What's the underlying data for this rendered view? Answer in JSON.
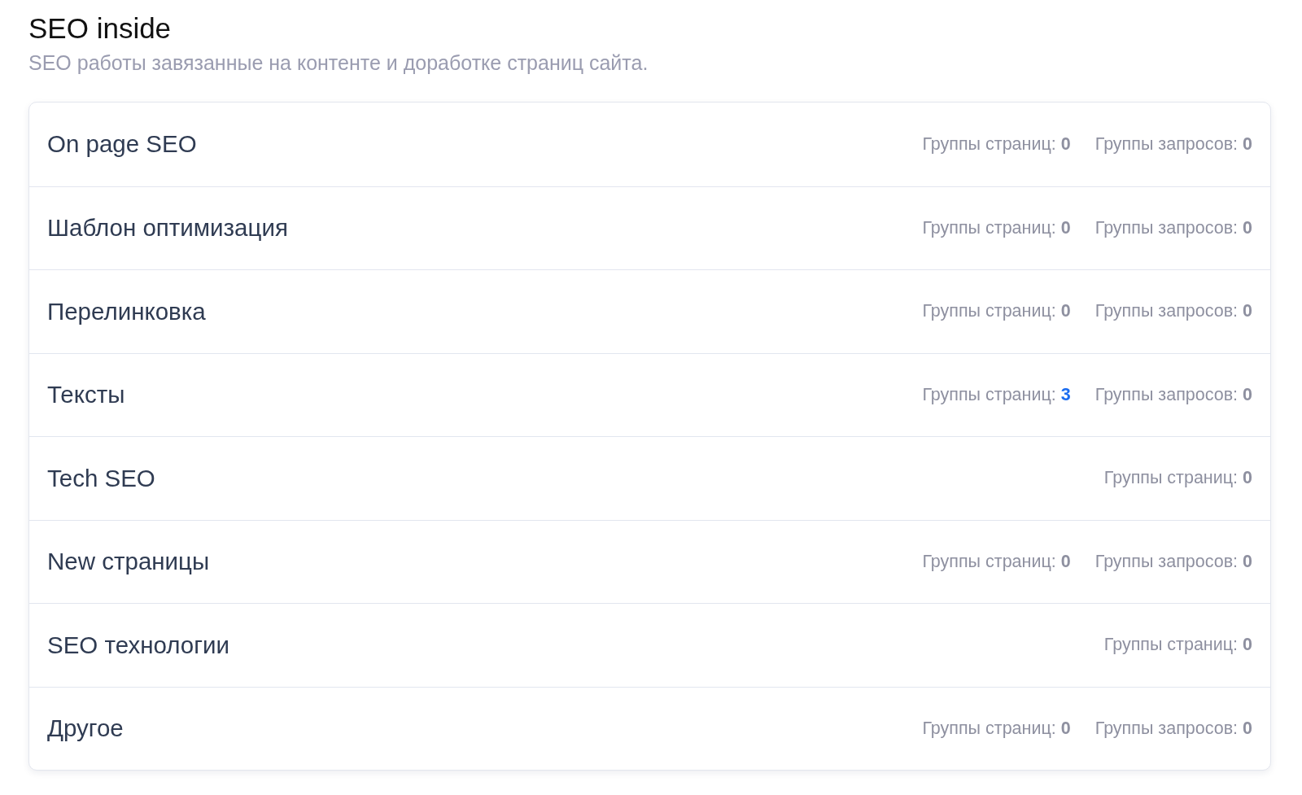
{
  "header": {
    "title": "SEO inside",
    "subtitle": "SEO работы завязанные на контенте и доработке страниц сайта."
  },
  "categories": [
    {
      "name": "On page SEO",
      "stats": [
        {
          "label": "Группы страниц:",
          "value": "0",
          "highlighted": false
        },
        {
          "label": "Группы запросов:",
          "value": "0",
          "highlighted": false
        }
      ]
    },
    {
      "name": "Шаблон оптимизация",
      "stats": [
        {
          "label": "Группы страниц:",
          "value": "0",
          "highlighted": false
        },
        {
          "label": "Группы запросов:",
          "value": "0",
          "highlighted": false
        }
      ]
    },
    {
      "name": "Перелинковка",
      "stats": [
        {
          "label": "Группы страниц:",
          "value": "0",
          "highlighted": false
        },
        {
          "label": "Группы запросов:",
          "value": "0",
          "highlighted": false
        }
      ]
    },
    {
      "name": "Тексты",
      "stats": [
        {
          "label": "Группы страниц:",
          "value": "3",
          "highlighted": true
        },
        {
          "label": "Группы запросов:",
          "value": "0",
          "highlighted": false
        }
      ]
    },
    {
      "name": "Tech SEO",
      "stats": [
        {
          "label": "Группы страниц:",
          "value": "0",
          "highlighted": false
        }
      ]
    },
    {
      "name": "New страницы",
      "stats": [
        {
          "label": "Группы страниц:",
          "value": "0",
          "highlighted": false
        },
        {
          "label": "Группы запросов:",
          "value": "0",
          "highlighted": false
        }
      ]
    },
    {
      "name": "SEO технологии",
      "stats": [
        {
          "label": "Группы страниц:",
          "value": "0",
          "highlighted": false
        }
      ]
    },
    {
      "name": "Другое",
      "stats": [
        {
          "label": "Группы страниц:",
          "value": "0",
          "highlighted": false
        },
        {
          "label": "Группы запросов:",
          "value": "0",
          "highlighted": false
        }
      ]
    }
  ]
}
